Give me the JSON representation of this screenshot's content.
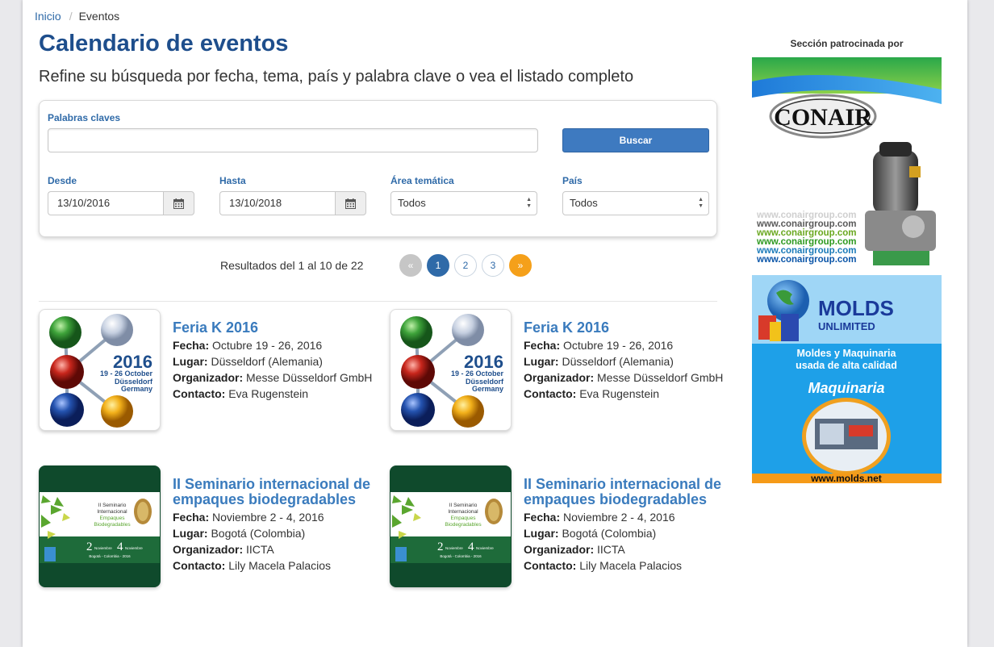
{
  "breadcrumb": {
    "home": "Inicio",
    "separator": "/",
    "current": "Eventos"
  },
  "page": {
    "title": "Calendario de eventos",
    "subtitle": "Refine su búsqueda por fecha, tema, país y palabra clave o vea el listado completo"
  },
  "search": {
    "keywords_label": "Palabras claves",
    "keywords_value": "",
    "search_button": "Buscar",
    "from_label": "Desde",
    "from_value": "13/10/2016",
    "to_label": "Hasta",
    "to_value": "13/10/2018",
    "area_label": "Área temática",
    "area_value": "Todos",
    "country_label": "País",
    "country_value": "Todos"
  },
  "results": {
    "text": "Resultados del 1 al 10 de 22",
    "pages": [
      "«",
      "1",
      "2",
      "3",
      "»"
    ],
    "active_page": "1"
  },
  "events": [
    {
      "title": "Feria K 2016",
      "fecha_label": "Fecha:",
      "fecha": "Octubre 19 - 26, 2016",
      "lugar_label": "Lugar:",
      "lugar": "Düsseldorf (Alemania)",
      "organizador_label": "Organizador:",
      "organizador": "Messe Düsseldorf GmbH",
      "contacto_label": "Contacto:",
      "contacto": "Eva Rugenstein",
      "logo": {
        "year": "2016",
        "dates": "19 - 26 October",
        "city": "Düsseldorf",
        "country": "Germany"
      }
    },
    {
      "title": "Feria K 2016",
      "fecha_label": "Fecha:",
      "fecha": "Octubre 19 - 26, 2016",
      "lugar_label": "Lugar:",
      "lugar": "Düsseldorf (Alemania)",
      "organizador_label": "Organizador:",
      "organizador": "Messe Düsseldorf GmbH",
      "contacto_label": "Contacto:",
      "contacto": "Eva Rugenstein",
      "logo": {
        "year": "2016",
        "dates": "19 - 26 October",
        "city": "Düsseldorf",
        "country": "Germany"
      }
    },
    {
      "title": "II Seminario internacional de empaques biodegradables",
      "fecha_label": "Fecha:",
      "fecha": "Noviembre 2 - 4, 2016",
      "lugar_label": "Lugar:",
      "lugar": "Bogotá (Colombia)",
      "organizador_label": "Organizador:",
      "organizador": "IICTA",
      "contacto_label": "Contacto:",
      "contacto": "Lily Macela Palacios",
      "banner": {
        "l1": "II Seminario",
        "l2": "Internacional",
        "l3": "Empaques",
        "l4": "Biodegradables",
        "start": "2",
        "end": "4",
        "month": "Noviembre",
        "place": "Bogotá - Colombia - 2016"
      }
    },
    {
      "title": "II Seminario internacional de empaques biodegradables",
      "fecha_label": "Fecha:",
      "fecha": "Noviembre 2 - 4, 2016",
      "lugar_label": "Lugar:",
      "lugar": "Bogotá (Colombia)",
      "organizador_label": "Organizador:",
      "organizador": "IICTA",
      "contacto_label": "Contacto:",
      "contacto": "Lily Macela Palacios",
      "banner": {
        "l1": "II Seminario",
        "l2": "Internacional",
        "l3": "Empaques",
        "l4": "Biodegradables",
        "start": "2",
        "end": "4",
        "month": "Noviembre",
        "place": "Bogotá - Colombia - 2016"
      }
    }
  ],
  "sidebar": {
    "sponsor_label": "Sección patrocinada por",
    "ad1": {
      "brand": "CONAIR",
      "url_lines": [
        "www.conairgroup.com",
        "www.conairgroup.com",
        "www.conairgroup.com",
        "www.conairgroup.com",
        "www.conairgroup.com",
        "www.conairgroup.com"
      ]
    },
    "ad2": {
      "brand_line1": "MOLDS",
      "brand_line2": "UNLIMITED",
      "tagline1": "Moldes y Maquinaria",
      "tagline2": "usada de alta calidad",
      "machinery": "Maquinaria",
      "url": "www.molds.net"
    }
  },
  "colors": {
    "title_blue": "#1e4e8c",
    "link_blue": "#2f6aa8",
    "button_blue": "#3e7ac0",
    "pager_next": "#f5a01a"
  }
}
